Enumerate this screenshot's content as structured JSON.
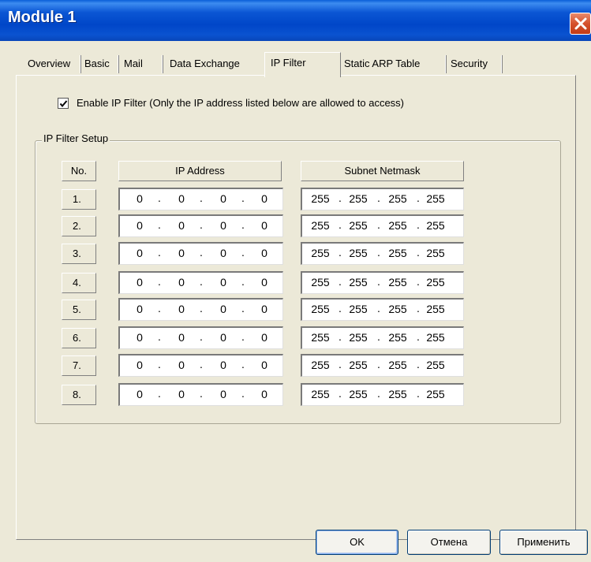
{
  "window": {
    "title": "Module 1"
  },
  "tabs": [
    {
      "label": "Overview"
    },
    {
      "label": "Basic"
    },
    {
      "label": "Mail"
    },
    {
      "label": "Data Exchange"
    },
    {
      "label": "IP Filter",
      "active": true
    },
    {
      "label": "Static ARP Table"
    },
    {
      "label": "Security"
    }
  ],
  "enable": {
    "checked": true,
    "label": "Enable IP Filter  (Only the IP address listed below are allowed to access)"
  },
  "group": {
    "label": "IP Filter Setup",
    "headers": {
      "no": "No.",
      "ip": "IP Address",
      "mask": "Subnet Netmask"
    },
    "rows": [
      {
        "no": "1.",
        "ip": [
          "0",
          "0",
          "0",
          "0"
        ],
        "mask": [
          "255",
          "255",
          "255",
          "255"
        ]
      },
      {
        "no": "2.",
        "ip": [
          "0",
          "0",
          "0",
          "0"
        ],
        "mask": [
          "255",
          "255",
          "255",
          "255"
        ]
      },
      {
        "no": "3.",
        "ip": [
          "0",
          "0",
          "0",
          "0"
        ],
        "mask": [
          "255",
          "255",
          "255",
          "255"
        ]
      },
      {
        "no": "4.",
        "ip": [
          "0",
          "0",
          "0",
          "0"
        ],
        "mask": [
          "255",
          "255",
          "255",
          "255"
        ]
      },
      {
        "no": "5.",
        "ip": [
          "0",
          "0",
          "0",
          "0"
        ],
        "mask": [
          "255",
          "255",
          "255",
          "255"
        ]
      },
      {
        "no": "6.",
        "ip": [
          "0",
          "0",
          "0",
          "0"
        ],
        "mask": [
          "255",
          "255",
          "255",
          "255"
        ]
      },
      {
        "no": "7.",
        "ip": [
          "0",
          "0",
          "0",
          "0"
        ],
        "mask": [
          "255",
          "255",
          "255",
          "255"
        ]
      },
      {
        "no": "8.",
        "ip": [
          "0",
          "0",
          "0",
          "0"
        ],
        "mask": [
          "255",
          "255",
          "255",
          "255"
        ]
      }
    ]
  },
  "buttons": {
    "ok": "OK",
    "cancel": "Отмена",
    "apply": "Применить"
  },
  "colors": {
    "titlebar": "#0054e3",
    "face": "#ece9d8",
    "close": "#d5512d"
  },
  "icons": {
    "close": "close-icon",
    "check": "checkmark-icon"
  }
}
